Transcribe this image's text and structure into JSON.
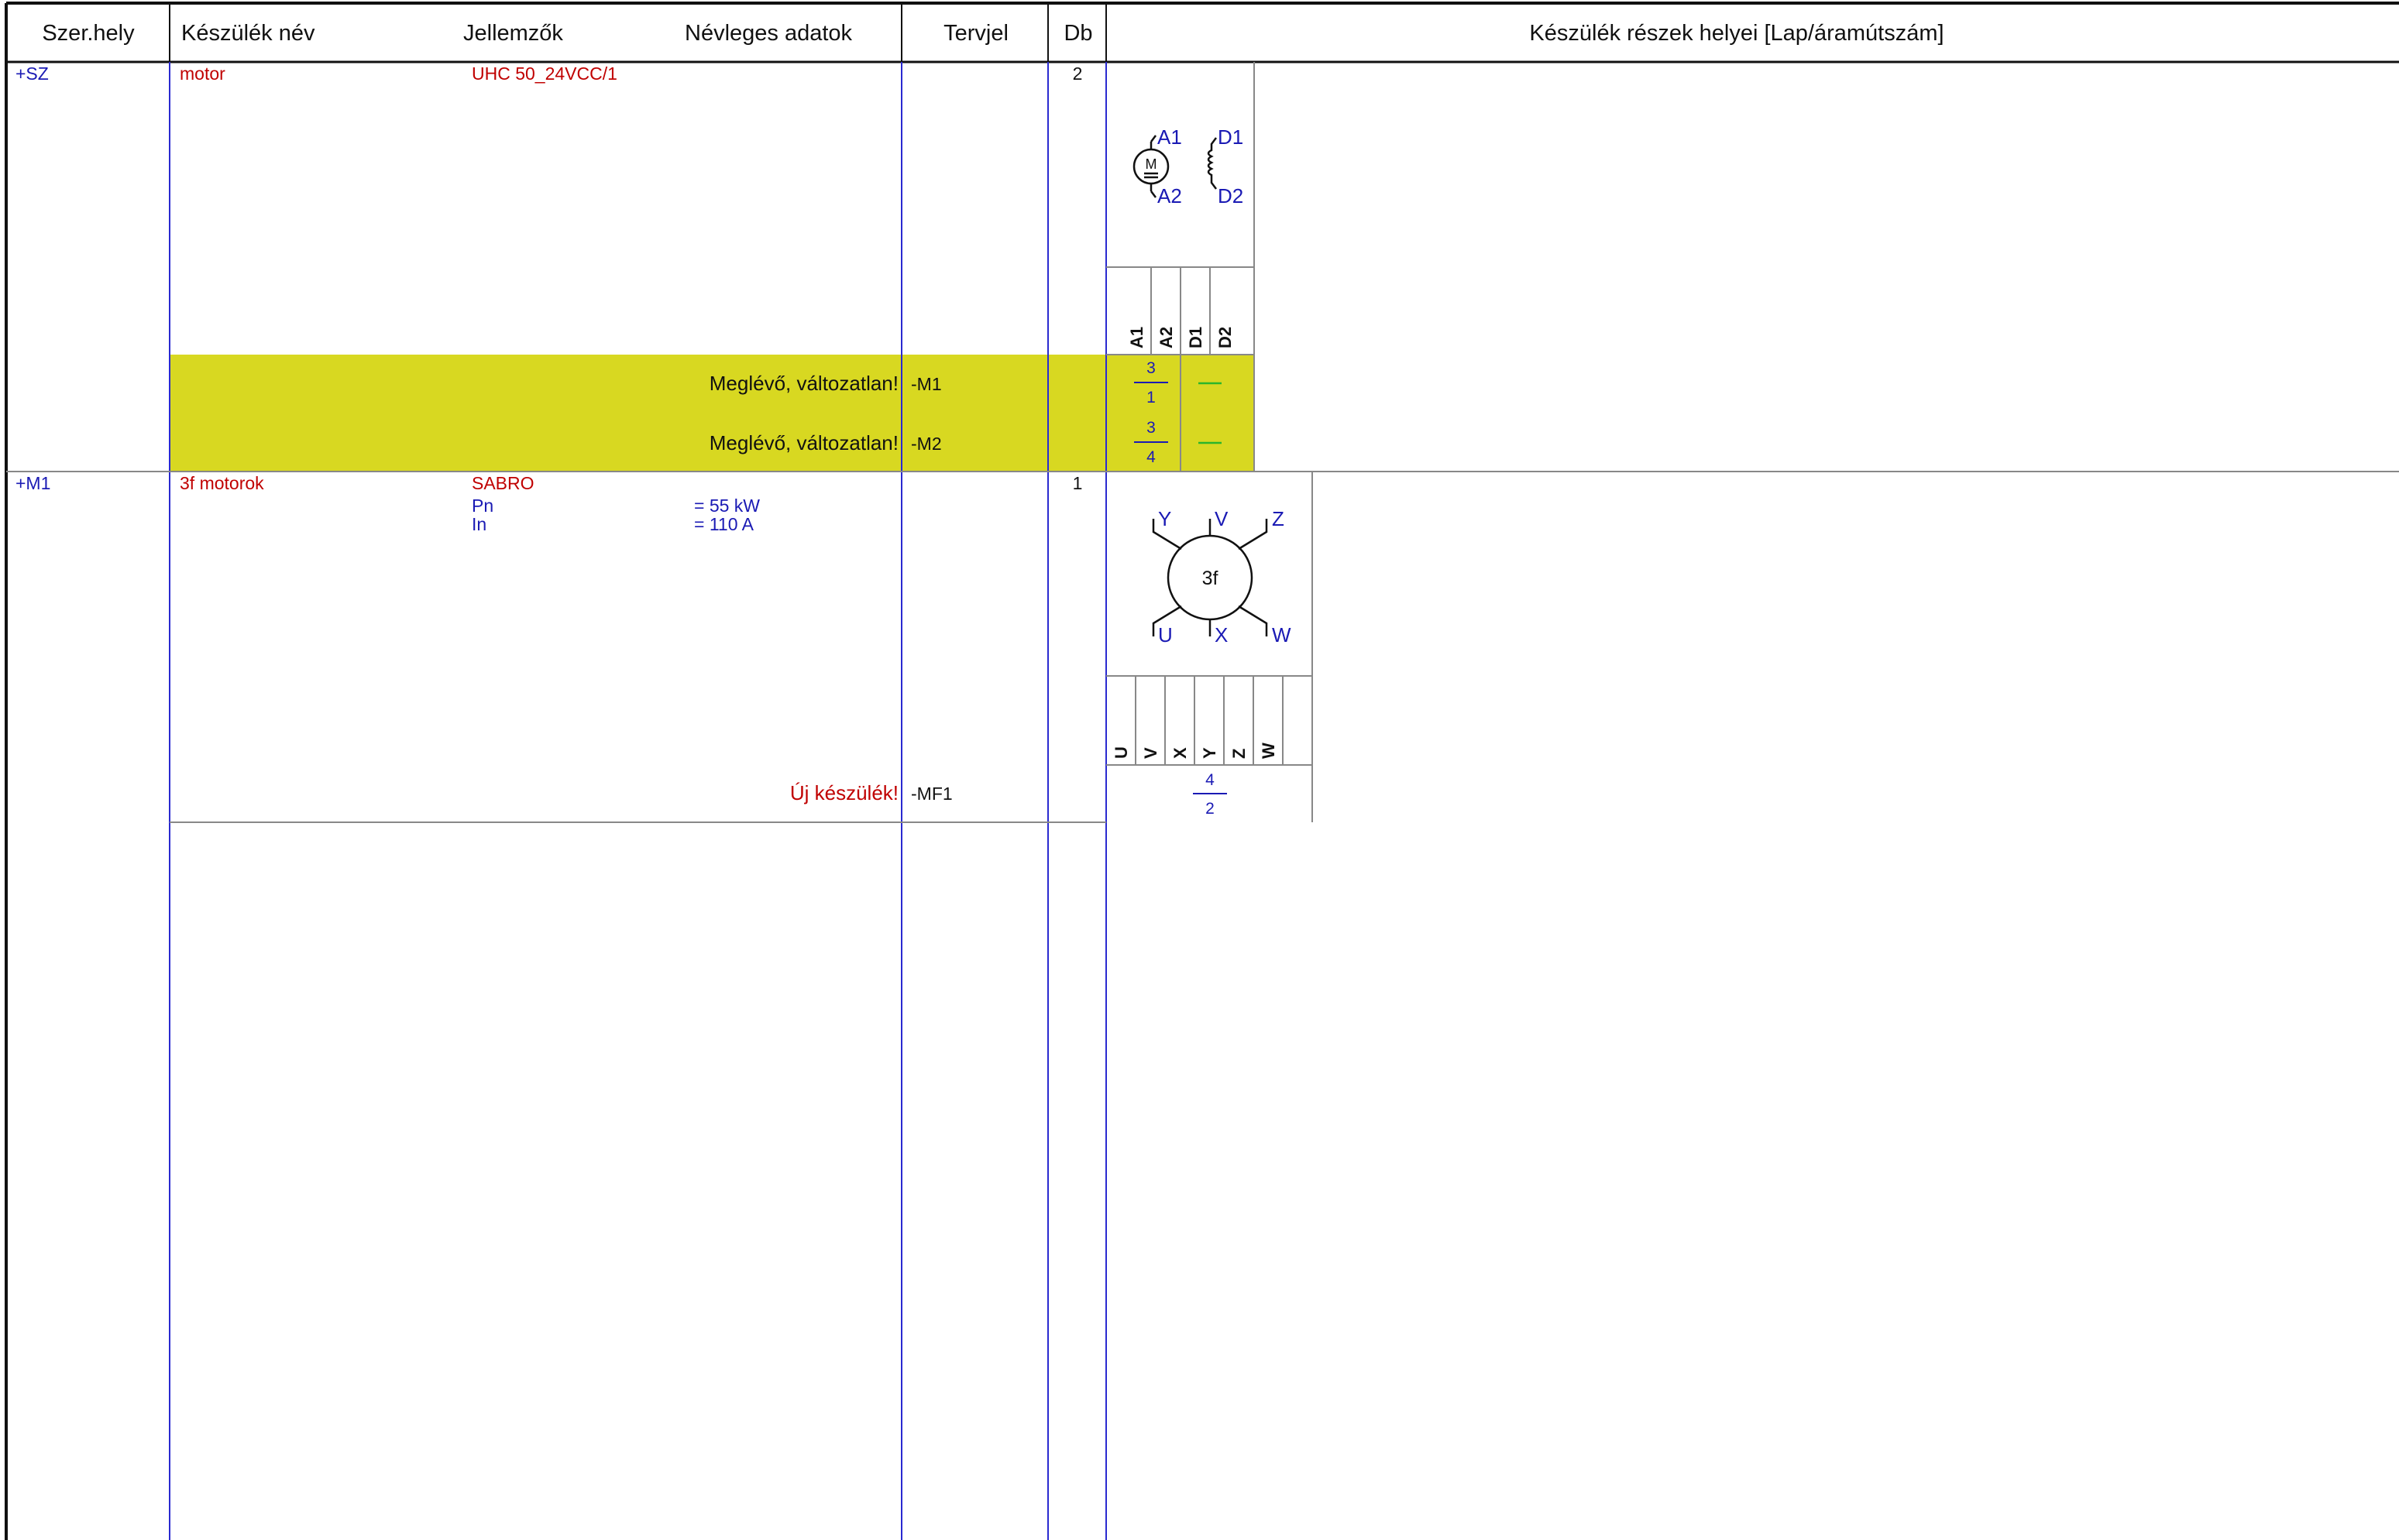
{
  "header": {
    "col_location": "Szer.hely",
    "col_device_name": "Készülék név",
    "col_characteristics": "Jellemzők",
    "col_rated_data": "Névleges adatok",
    "col_designation": "Tervjel",
    "col_qty": "Db",
    "col_part_locations": "Készülék részek helyei [Lap/áramútszám]"
  },
  "colors": {
    "blue_ink": "#1a1ab4",
    "red_ink": "#c00000",
    "highlight": "#d8d821",
    "green_dash": "#2bb52b"
  },
  "rows": [
    {
      "location": "+SZ",
      "name": "motor",
      "characteristics": "UHC 50_24VCC/1",
      "qty": "2",
      "symbol": "dc-motor-with-field-winding-icon",
      "symbol_labels": {
        "a1": "A1",
        "a2": "A2",
        "d1": "D1",
        "d2": "D2",
        "m": "M"
      },
      "terminals": [
        "A1",
        "A2",
        "D1",
        "D2"
      ],
      "entries": [
        {
          "status": "Meglévő, változatlan!",
          "designation": "-M1",
          "page": "3",
          "path": "1"
        },
        {
          "status": "Meglévő, változatlan!",
          "designation": "-M2",
          "page": "3",
          "path": "4"
        }
      ]
    },
    {
      "location": "+M1",
      "name": "3f motorok",
      "characteristics": "SABRO",
      "params": [
        {
          "name": "Pn",
          "value": "= 55 kW"
        },
        {
          "name": "In",
          "value": "= 110 A"
        }
      ],
      "qty": "1",
      "symbol": "three-phase-motor-icon",
      "symbol_labels": {
        "center": "3f",
        "y": "Y",
        "v": "V",
        "z": "Z",
        "u": "U",
        "x": "X",
        "w": "W"
      },
      "terminals": [
        "U",
        "V",
        "X",
        "Y",
        "Z",
        "W"
      ],
      "entries": [
        {
          "status": "Új készülék!",
          "designation": "-MF1",
          "page": "4",
          "path": "2"
        }
      ]
    }
  ]
}
